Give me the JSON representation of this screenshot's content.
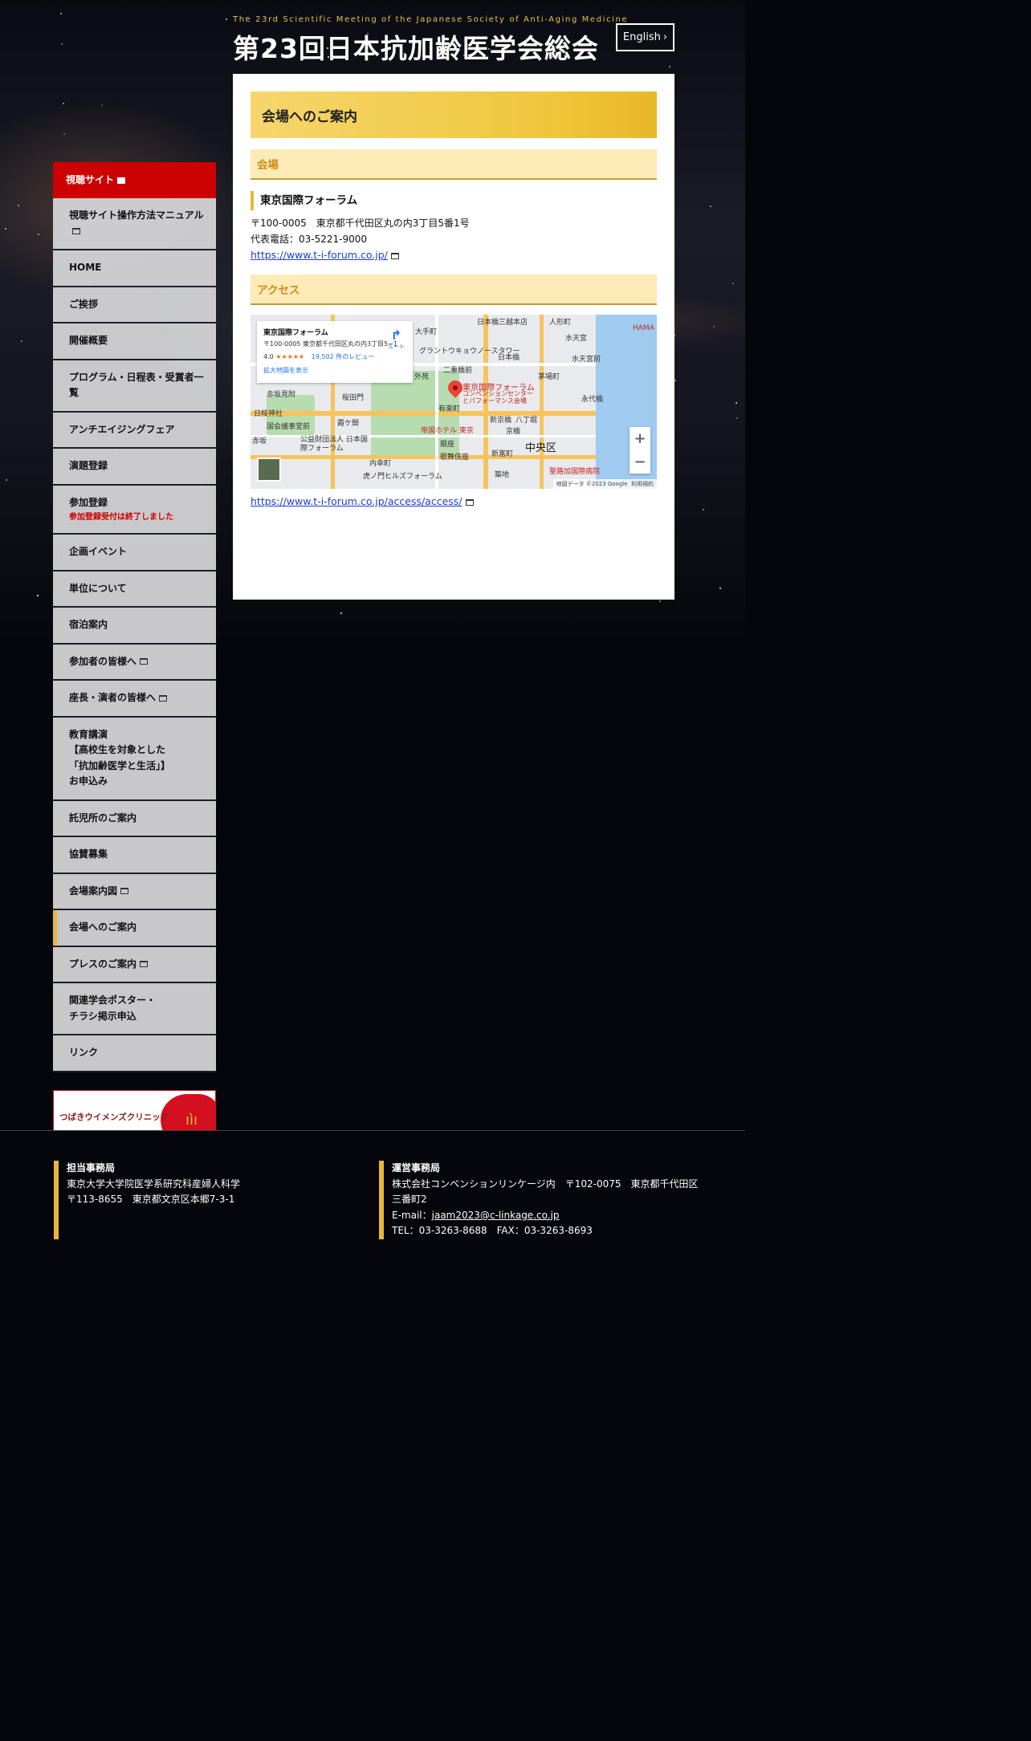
{
  "header": {
    "subtitle": "The 23rd Scientific Meeting of the Japanese Society of Anti-Aging Medicine",
    "title": "第23回日本抗加齢医学会総会",
    "english_label": "English"
  },
  "sidebar": {
    "live_site": "視聴サイト",
    "items": [
      {
        "label": "視聴サイト操作方法マニュアル",
        "external": true
      },
      {
        "label": "HOME"
      },
      {
        "label": "ご挨拶"
      },
      {
        "label": "開催概要"
      },
      {
        "label": "プログラム・日程表・受賞者一覧"
      },
      {
        "label": "アンチエイジングフェア"
      },
      {
        "label": "演題登録"
      },
      {
        "label": "参加登録",
        "note": "参加登録受付は終了しました"
      },
      {
        "label": "企画イベント"
      },
      {
        "label": "単位について"
      },
      {
        "label": "宿泊案内"
      },
      {
        "label": "参加者の皆様へ",
        "external": true
      },
      {
        "label": "座長・演者の皆様へ",
        "external": true
      },
      {
        "label": "教育講演\n【高校生を対象とした\n「抗加齢医学と生活」】\nお申込み"
      },
      {
        "label": "託児所のご案内"
      },
      {
        "label": "協賛募集"
      },
      {
        "label": "会場案内図",
        "external": true
      },
      {
        "label": "会場へのご案内",
        "current": true
      },
      {
        "label": "プレスのご案内",
        "external": true
      },
      {
        "label": "関連学会ポスター・\nチラシ掲示申込"
      },
      {
        "label": "リンク"
      }
    ],
    "banner_text": "つばきウイメンズクリニック"
  },
  "main": {
    "page_title": "会場へのご案内",
    "venue_heading": "会場",
    "venue_name": "東京国際フォーラム",
    "address": "〒100-0005　東京都千代田区丸の内3丁目5番1号",
    "phone": "代表電話：03-5221-9000",
    "venue_url": "https://www.t-i-forum.co.jp/",
    "access_heading": "アクセス",
    "access_url": "https://www.t-i-forum.co.jp/access/access/"
  },
  "map": {
    "card_name": "東京国際フォーラム",
    "card_address": "〒100-0005 東京都千代田区丸の内3丁目5−1",
    "rating": "4.0",
    "stars": "★★★★★",
    "reviews": "19,502 件のレビュー",
    "larger_map": "拡大地図を表示",
    "directions": "ルート",
    "pin_label": "東京国際フォーラム",
    "pin_sublabel": "コンベンションセンター\nとパフォーマンス会場",
    "labels": [
      "日本橋三越本店",
      "人形町",
      "水天宮",
      "大手町",
      "グラントウキョウノースタワー",
      "日本橋",
      "水天宮前",
      "二重橋前",
      "茅場町",
      "永代橋",
      "外苑",
      "有楽町",
      "桜田門",
      "日枝神社",
      "赤坂見附",
      "帝国ホテル 東京",
      "国会議事堂前",
      "霞ケ関",
      "新京橋",
      "八丁堀",
      "公益財団法人 日本国際フォーラム",
      "京橋",
      "銀座",
      "歌舞伎座",
      "新富町",
      "中央区",
      "内幸町",
      "聖路加国際病院",
      "虎ノ門ヒルズフォーラム",
      "築地",
      "赤坂",
      "HAMA"
    ],
    "copyright": "地図データ ©2023 Google",
    "terms": "利用規約"
  },
  "footer": {
    "left": {
      "heading": "担当事務局",
      "line1": "東京大学大学院医学系研究科産婦人科学",
      "line2": "〒113-8655　東京都文京区本郷7-3-1"
    },
    "right": {
      "heading": "運営事務局",
      "line1": "株式会社コンベンションリンケージ内　〒102-0075　東京都千代田区",
      "line2": "三番町2",
      "email_label": "E-mail：",
      "email": "jaam2023@c-linkage.co.jp",
      "tel": "TEL：03-3263-8688　FAX：03-3263-8693"
    }
  },
  "colors": {
    "accent_gold": "#e7b63a",
    "live_red": "#cc0000",
    "section_text": "#cf8b19",
    "link_blue": "#1a3ed2"
  }
}
